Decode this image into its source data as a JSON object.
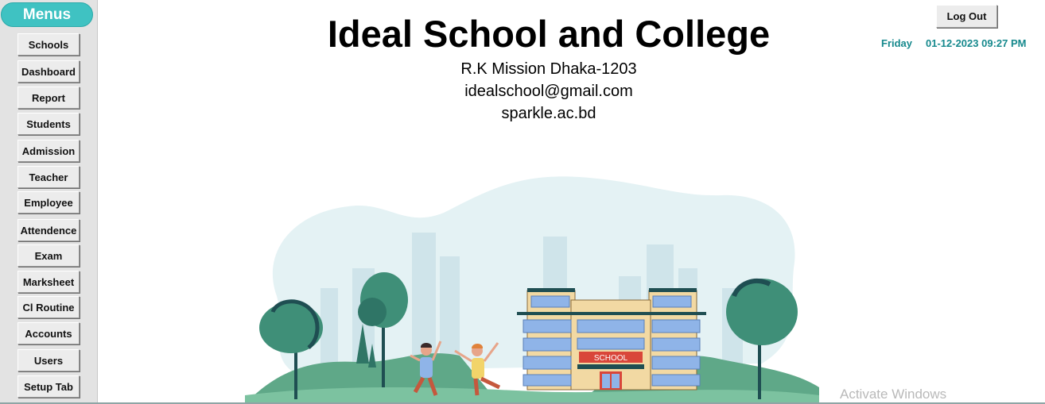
{
  "sidebar": {
    "title": "Menus",
    "items": [
      {
        "label": "Schools"
      },
      {
        "label": "Dashboard"
      },
      {
        "label": "Report"
      },
      {
        "label": "Students"
      },
      {
        "label": "Admission"
      },
      {
        "label": "Teacher"
      },
      {
        "label": "Employee"
      },
      {
        "label": "Attendence"
      },
      {
        "label": "Exam"
      },
      {
        "label": "Marksheet"
      },
      {
        "label": "Cl Routine"
      },
      {
        "label": "Accounts"
      },
      {
        "label": "Users"
      },
      {
        "label": "Setup Tab"
      }
    ]
  },
  "header": {
    "school_name": "Ideal School and College",
    "address": "R.K Mission Dhaka-1203",
    "email": "idealschool@gmail.com",
    "website": "sparkle.ac.bd",
    "logout_label": "Log Out",
    "day": "Friday",
    "datetime": "01-12-2023 09:27 PM"
  },
  "illustration": {
    "building_sign": "SCHOOL",
    "colors": {
      "tree_green": "#3f8f78",
      "tree_dark": "#1f4e52",
      "sky_wash": "#e4f2f4",
      "building": "#f2d9a3",
      "sign_red": "#d9463a"
    }
  },
  "watermark": "Activate Windows",
  "colors": {
    "accent": "#3fc2c2",
    "datetime": "#16898d"
  }
}
